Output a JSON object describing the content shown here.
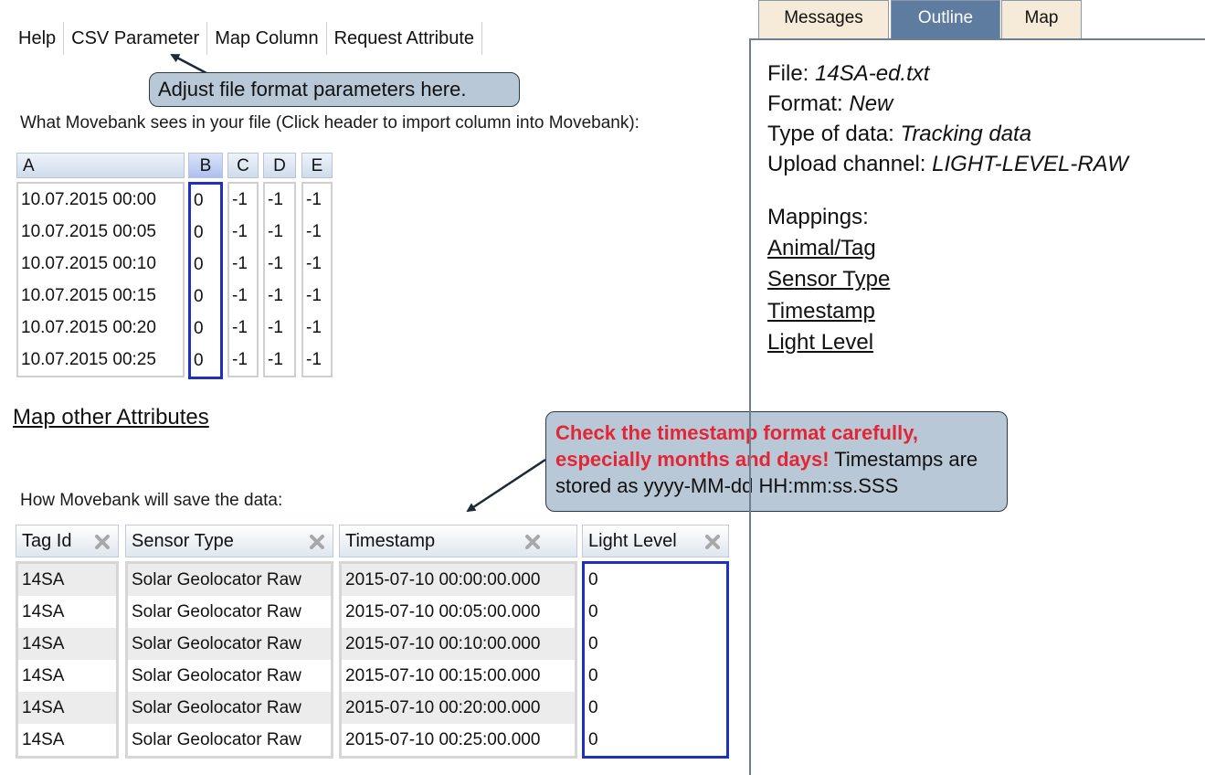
{
  "menu": [
    "Help",
    "CSV Parameter",
    "Map Column",
    "Request Attribute"
  ],
  "callouts": {
    "csv": "Adjust file format parameters here.",
    "timestamp_red": "Check the timestamp format carefully, especially months and days!",
    "timestamp_rest": "Timestamps are stored as yyyy-MM-dd HH:mm:ss.SSS"
  },
  "file_intro": "What Movebank sees in your file (Click header to import column into Movebank):",
  "file_table": {
    "headers": [
      "A",
      "B",
      "C",
      "D",
      "E"
    ],
    "A": [
      "10.07.2015 00:00",
      "10.07.2015 00:05",
      "10.07.2015 00:10",
      "10.07.2015 00:15",
      "10.07.2015 00:20",
      "10.07.2015 00:25"
    ],
    "B": [
      "0",
      "0",
      "0",
      "0",
      "0",
      "0"
    ],
    "C": [
      "-1",
      "-1",
      "-1",
      "-1",
      "-1",
      "-1"
    ],
    "D": [
      "-1",
      "-1",
      "-1",
      "-1",
      "-1",
      "-1"
    ],
    "E": [
      "-1",
      "-1",
      "-1",
      "-1",
      "-1",
      "-1"
    ]
  },
  "map_other": "Map other Attributes",
  "save_intro": "How Movebank will save the data:",
  "save_table": {
    "headers": [
      "Tag Id",
      "Sensor Type",
      "Timestamp",
      "Light Level"
    ],
    "tag_id": [
      "14SA",
      "14SA",
      "14SA",
      "14SA",
      "14SA",
      "14SA"
    ],
    "sensor_type": [
      "Solar Geolocator Raw",
      "Solar Geolocator Raw",
      "Solar Geolocator Raw",
      "Solar Geolocator Raw",
      "Solar Geolocator Raw",
      "Solar Geolocator Raw"
    ],
    "timestamp": [
      "2015-07-10 00:00:00.000",
      "2015-07-10 00:05:00.000",
      "2015-07-10 00:10:00.000",
      "2015-07-10 00:15:00.000",
      "2015-07-10 00:20:00.000",
      "2015-07-10 00:25:00.000"
    ],
    "light_level": [
      "0",
      "0",
      "0",
      "0",
      "0",
      "0"
    ],
    "remove_icon": "close-x-icon"
  },
  "tabs": [
    "Messages",
    "Outline",
    "Map"
  ],
  "active_tab": "Outline",
  "outline": {
    "file_label": "File:",
    "file_value": "14SA-ed.txt",
    "format_label": "Format:",
    "format_value": "New",
    "type_label": "Type of data:",
    "type_value": "Tracking data",
    "channel_label": "Upload channel:",
    "channel_value": "LIGHT-LEVEL-RAW",
    "mappings_label": "Mappings:",
    "mappings": [
      "Animal/Tag",
      "Sensor Type",
      "Timestamp",
      "Light Level"
    ]
  },
  "colors": {
    "callout_bg": "#b9c8d6",
    "callout_red": "#e32636",
    "highlight_border": "#1f2fbe",
    "active_tab": "#5e7ca0",
    "inactive_tab": "#f5ebd8"
  }
}
